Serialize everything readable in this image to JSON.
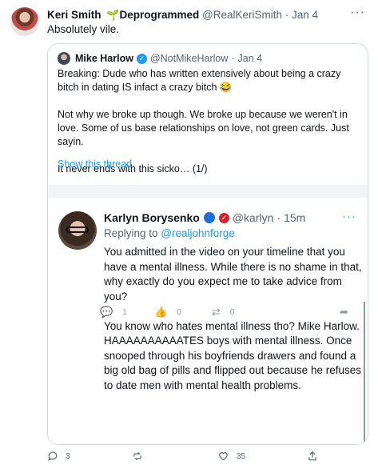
{
  "tweet": {
    "author_name": "Keri Smith",
    "badge_emoji": "🌱",
    "badge_text": "Deprogrammed",
    "handle": "@RealKeriSmith",
    "separator": "·",
    "date": "Jan 4",
    "more": "···",
    "text": "Absolutely vile."
  },
  "quoted": {
    "author_name": "Mike Harlow",
    "handle": "@NotMikeHarlow",
    "separator": "·",
    "date": "Jan 4",
    "paragraph1": "Breaking: Dude who has written extensively about being a crazy bitch in dating IS infact a crazy bitch 😂",
    "paragraph2": "Not why we broke up though. We broke up because we weren't in love. Some of us base relationships on love, not green cards. Just sayin.",
    "paragraph3": "It never ends with this sicko… (1/)",
    "show_thread": "Show this thread"
  },
  "embedded": {
    "author_name": "Karlyn Borysenko",
    "handle": "@karlyn",
    "separator": "·",
    "time": "15m",
    "more": "···",
    "replying_prefix": "Replying to",
    "replying_to": "@realjohnforge",
    "paragraph1": "You admitted in the video on your timeline that you have a mental illness. While there is no shame in that, why exactly do you expect me to take advice from you?",
    "paragraph2": "You know who hates mental illness tho? Mike Harlow. HAAAAAAAAAATES boys with mental illness. Once snooped through his boyfriends drawers and found a big old bag of pills and flipped out because he refuses to date men with mental health problems.",
    "reply_count": "1",
    "like_count": "0",
    "retweet_count": "0"
  },
  "actions": {
    "reply_count": "3",
    "retweet_count": "",
    "like_count": "35"
  },
  "colors": {
    "link": "#1d9bf0",
    "muted": "#536471",
    "border": "#cfd9de"
  }
}
